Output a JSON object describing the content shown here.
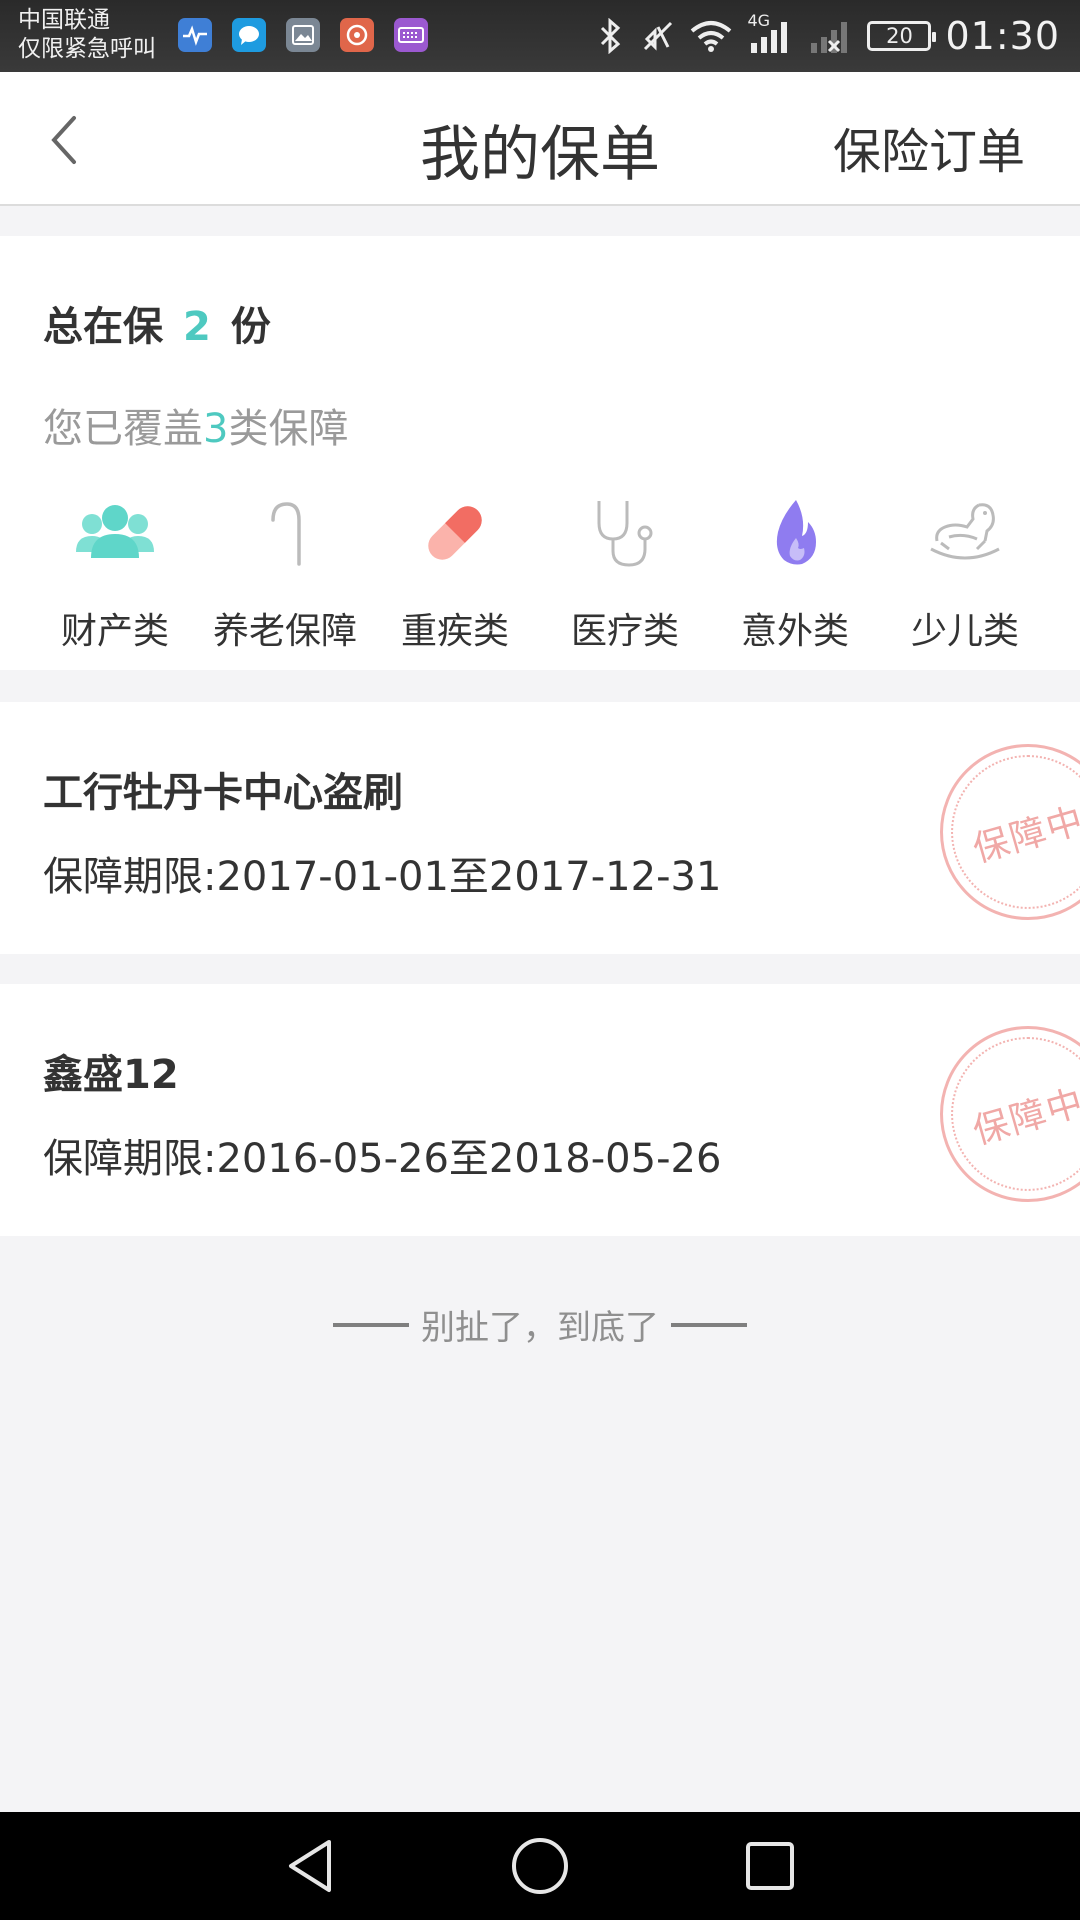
{
  "status_bar": {
    "carrier_line1": "中国联通",
    "carrier_line2": "仅限紧急呼叫",
    "network": "4G",
    "battery": "20",
    "time": "01:30",
    "notification_icons": [
      "health-app-icon",
      "message-icon",
      "gallery-icon",
      "app-icon",
      "keyboard-icon"
    ]
  },
  "header": {
    "title": "我的保单",
    "right_link": "保险订单"
  },
  "summary": {
    "total_prefix": "总在保",
    "total_count": "2",
    "total_suffix": "份",
    "covered_prefix": "您已覆盖",
    "covered_count": "3",
    "covered_suffix": "类保障",
    "categories": [
      {
        "label": "财产类",
        "icon": "people-icon",
        "color": "#5fd6c9"
      },
      {
        "label": "养老保障",
        "icon": "cane-icon",
        "color": "#bbbbbb"
      },
      {
        "label": "重疾类",
        "icon": "pill-icon",
        "color": "#f26d63"
      },
      {
        "label": "医疗类",
        "icon": "stethoscope-icon",
        "color": "#bbbbbb"
      },
      {
        "label": "意外类",
        "icon": "flame-icon",
        "color": "#8f7cf0"
      },
      {
        "label": "少儿类",
        "icon": "rocking-horse-icon",
        "color": "#bbbbbb"
      }
    ]
  },
  "policies": [
    {
      "name": "工行牡丹卡中心盗刷",
      "period": "保障期限:2017-01-01至2017-12-31",
      "stamp": "保障中"
    },
    {
      "name": "鑫盛12",
      "period": "保障期限:2016-05-26至2018-05-26",
      "stamp": "保障中"
    }
  ],
  "footer": {
    "end_text": "别扯了，到底了"
  }
}
